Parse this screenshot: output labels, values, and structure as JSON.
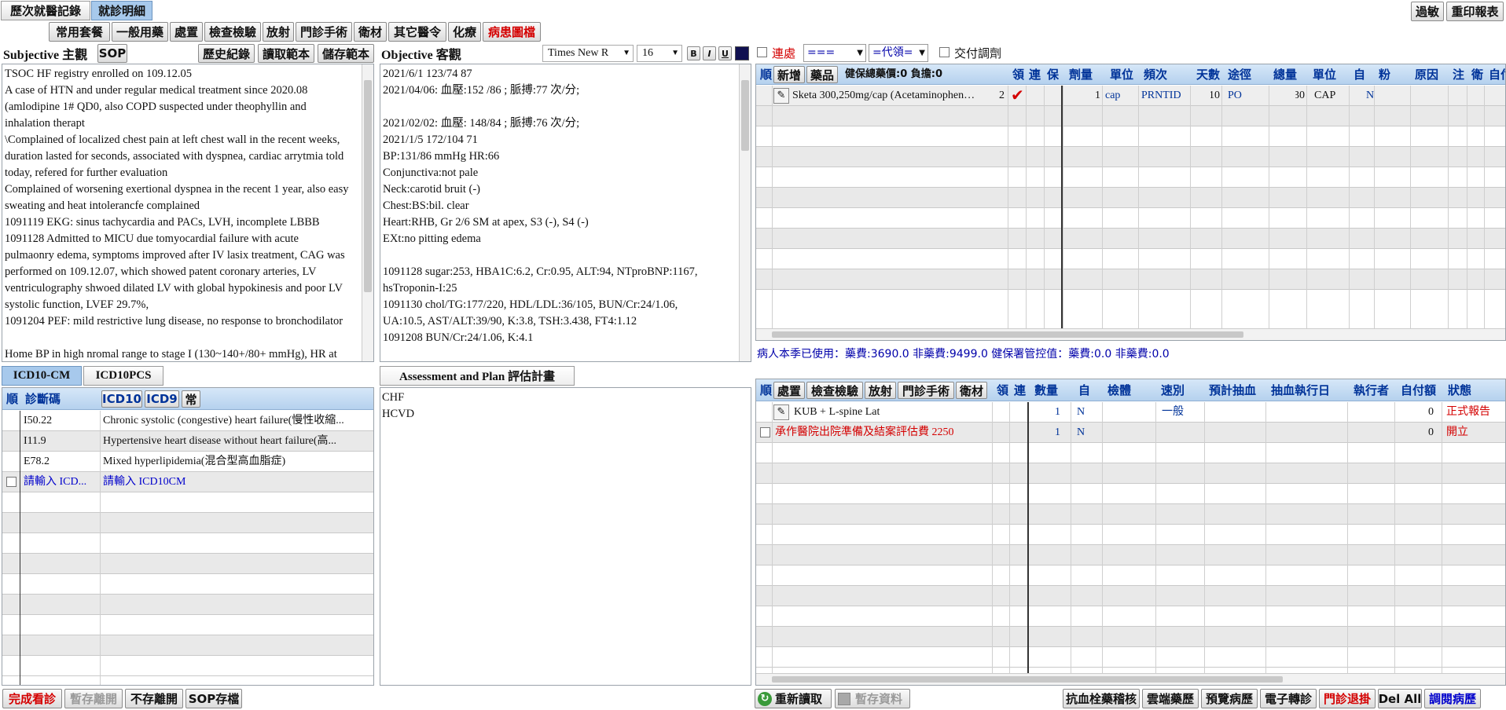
{
  "top_tabs": [
    "歷次就醫記錄",
    "就診明細"
  ],
  "top_right": {
    "allergy": "過敏",
    "reprint": "重印報表"
  },
  "toolbar": [
    "常用套餐",
    "一般用藥",
    "處置",
    "檢查檢驗",
    "放射",
    "門診手術",
    "衛材",
    "其它醫令",
    "化療",
    "病患圖檔"
  ],
  "subjective": {
    "title": "Subjective 主觀",
    "sop": "SOP",
    "history": "歷史紀錄",
    "read_template": "讀取範本",
    "save_template": "儲存範本",
    "lines": [
      "TSOC HF registry enrolled on 109.12.05",
      "A case of HTN and under regular medical treatment since 2020.08",
      "(amlodipine 1# QD0, also COPD suspected under theophyllin and",
      "inhalation therapt",
      "\\Complained of localized chest pain at left chest wall in the recent weeks,",
      "duration lasted for seconds, associated with dyspnea, cardiac arrytmia told",
      "today, refered for further evaluation",
      "Complained of worsening exertional dyspnea in the recent 1 year, also easy",
      "sweating and heat intolerancfe complained",
      "1091119 EKG: sinus tachycardia and PACs, LVH, incomplete LBBB",
      "1091128 Admitted to MICU due tomyocardial failure with acute",
      "pulmaonry edema, symptoms improved after IV lasix treatment, CAG was",
      "performed on 109.12.07, which showed patent coronary arteries, LV",
      "ventriculography shwoed dilated LV with global hypokinesis and poor LV",
      "systolic function, LVEF 29.7%,",
      "1091204 PEF: mild restrictive lung disease, no response to bronchodilator",
      "",
      "Home BP in high nromal range to stage I (130~140+/80+ mmHg), HR at"
    ]
  },
  "objective": {
    "title": "Objective 客觀",
    "font": "Times New R",
    "size": "16",
    "fmt": [
      "B",
      "I",
      "U"
    ],
    "lines": [
      "2021/6/1 123/74 87",
      "2021/04/06: 血壓:152 /86 ; 脈搏:77  次/分;",
      "",
      "2021/02/02: 血壓: 148/84 ; 脈搏:76  次/分;",
      "2021/1/5 172/104 71",
      "BP:131/86 mmHg  HR:66",
      "Conjunctiva:not pale",
      "Neck:carotid bruit (-)",
      "Chest:BS:bil. clear",
      "Heart:RHB, Gr 2/6 SM at apex, S3 (-), S4 (-)",
      "EXt:no pitting edema",
      "",
      "1091128 sugar:253, HBA1C:6.2, Cr:0.95, ALT:94, NTproBNP:1167,",
      "hsTroponin-I:25",
      "1091130 chol/TG:177/220, HDL/LDL:36/105, BUN/Cr:24/1.06,",
      "UA:10.5, AST/ALT:39/90, K:3.8, TSH:3.438, FT4:1.12",
      "1091208 BUN/Cr:24/1.06, K:4.1"
    ]
  },
  "med_options": {
    "continuous": "連處",
    "combo1": "===",
    "combo2": "=代領=",
    "deliver": "交付調劑"
  },
  "med_table": {
    "new_btn": "新增",
    "drug_btn": "藥品",
    "summary": "健保總藥價:0 負擔:0",
    "headers": [
      "領",
      "連",
      "保",
      "劑量",
      "單位",
      "頻次",
      "天數",
      "途徑",
      "總量",
      "單位",
      "自",
      "粉",
      "原因",
      "注",
      "衛",
      "自付"
    ],
    "rows": [
      {
        "name": "Sketa 300,250mg/cap (Acetaminophen…",
        "code": "2",
        "dose": "1",
        "unit": "cap",
        "freq": "PRNTID",
        "days": "10",
        "route": "PO",
        "total": "30",
        "tunit": "CAP",
        "self": "N"
      }
    ]
  },
  "usage_line": "病人本季已使用：藥費:3690.0 非藥費:9499.0 健保署管控值：藥費:0.0 非藥費:0.0",
  "icd": {
    "tabs": [
      "ICD10-CM",
      "ICD10PCS"
    ],
    "headers": {
      "order": "順",
      "code": "診斷碼"
    },
    "btns": [
      "ICD10",
      "ICD9",
      "常"
    ],
    "rows": [
      {
        "code": "I50.22",
        "desc": "Chronic systolic (congestive) heart failure(慢性收縮..."
      },
      {
        "code": "I11.9",
        "desc": "Hypertensive heart disease without heart failure(高..."
      },
      {
        "code": "E78.2",
        "desc": "Mixed hyperlipidemia(混合型高血脂症)"
      },
      {
        "code": "請輸入 ICD...",
        "desc": "請輸入 ICD10CM"
      }
    ]
  },
  "assessment": {
    "tab": "Assessment and Plan 評估計畫",
    "lines": [
      "CHF",
      "HCVD"
    ]
  },
  "order_table": {
    "btns": [
      "處置",
      "檢查檢驗",
      "放射",
      "門診手術",
      "衛材"
    ],
    "headers": [
      "領",
      "連",
      "數量",
      "自",
      "檢體",
      "速別",
      "預計抽血",
      "抽血執行日",
      "執行者",
      "自付額",
      "狀態"
    ],
    "rows": [
      {
        "name": "KUB + L-spine Lat",
        "qty": "1",
        "self": "N",
        "speed": "一般",
        "copay": "0",
        "status": "正式報告",
        "color": "#111111",
        "status_color": "#d40000"
      },
      {
        "name": "承作醫院出院準備及結案評估費 2250",
        "qty": "1",
        "self": "N",
        "speed": "",
        "copay": "0",
        "status": "開立",
        "color": "#d40000",
        "status_color": "#d40000"
      }
    ]
  },
  "bottom_left": [
    "完成看診",
    "暫存離開",
    "不存離開",
    "SOP存檔"
  ],
  "bottom_mid": [
    "重新讀取",
    "暫存資料"
  ],
  "bottom_right": [
    "抗血栓藥稽核",
    "雲端藥歷",
    "預覽病歷",
    "電子轉診",
    "門診退掛",
    "Del All",
    "調閱病歷"
  ],
  "colors": {
    "header_bg": "#b5d1ee",
    "header_text": "#003399",
    "red": "#d40000",
    "active_tab": "#a7c9ec"
  }
}
